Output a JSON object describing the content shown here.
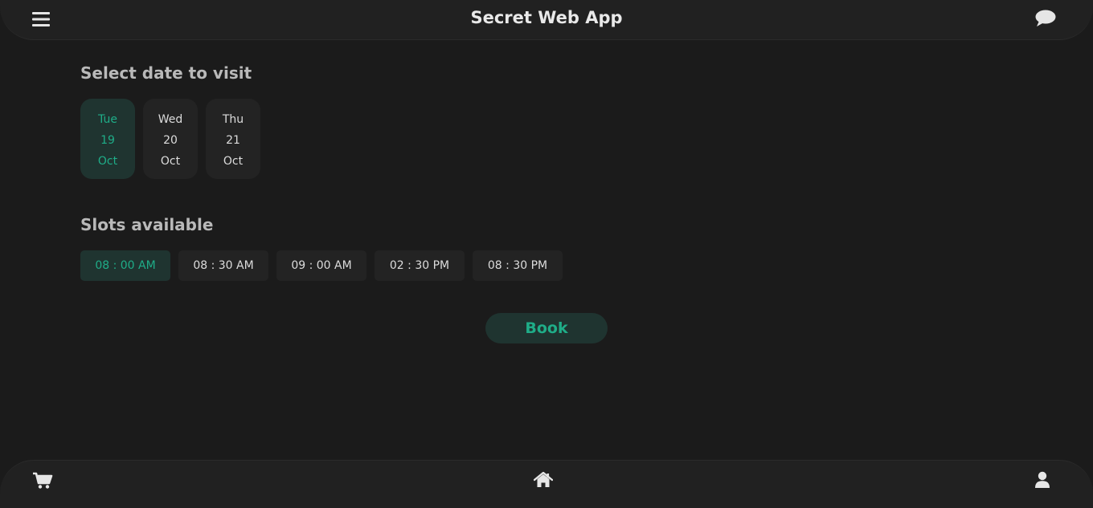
{
  "header": {
    "title": "Secret Web App",
    "menu_icon": "hamburger-menu-icon",
    "chat_icon": "chat-bubble-icon"
  },
  "date_section": {
    "title": "Select date to visit",
    "dates": [
      {
        "day": "Tue",
        "date": "19",
        "month": "Oct",
        "selected": true
      },
      {
        "day": "Wed",
        "date": "20",
        "month": "Oct",
        "selected": false
      },
      {
        "day": "Thu",
        "date": "21",
        "month": "Oct",
        "selected": false
      }
    ]
  },
  "slots_section": {
    "title": "Slots available",
    "slots": [
      {
        "label": "08 : 00 AM",
        "selected": true
      },
      {
        "label": "08 : 30 AM",
        "selected": false
      },
      {
        "label": "09 : 00 AM",
        "selected": false
      },
      {
        "label": "02 : 30 PM",
        "selected": false
      },
      {
        "label": "08 : 30 PM",
        "selected": false
      }
    ]
  },
  "book_button": {
    "label": "Book"
  },
  "bottom_nav": {
    "items": [
      {
        "icon": "cart-icon"
      },
      {
        "icon": "home-icon"
      },
      {
        "icon": "user-icon"
      }
    ]
  },
  "colors": {
    "background": "#1b1b1b",
    "bar": "#212121",
    "accent": "#1fad88",
    "selected_bg": "#1f3430"
  }
}
